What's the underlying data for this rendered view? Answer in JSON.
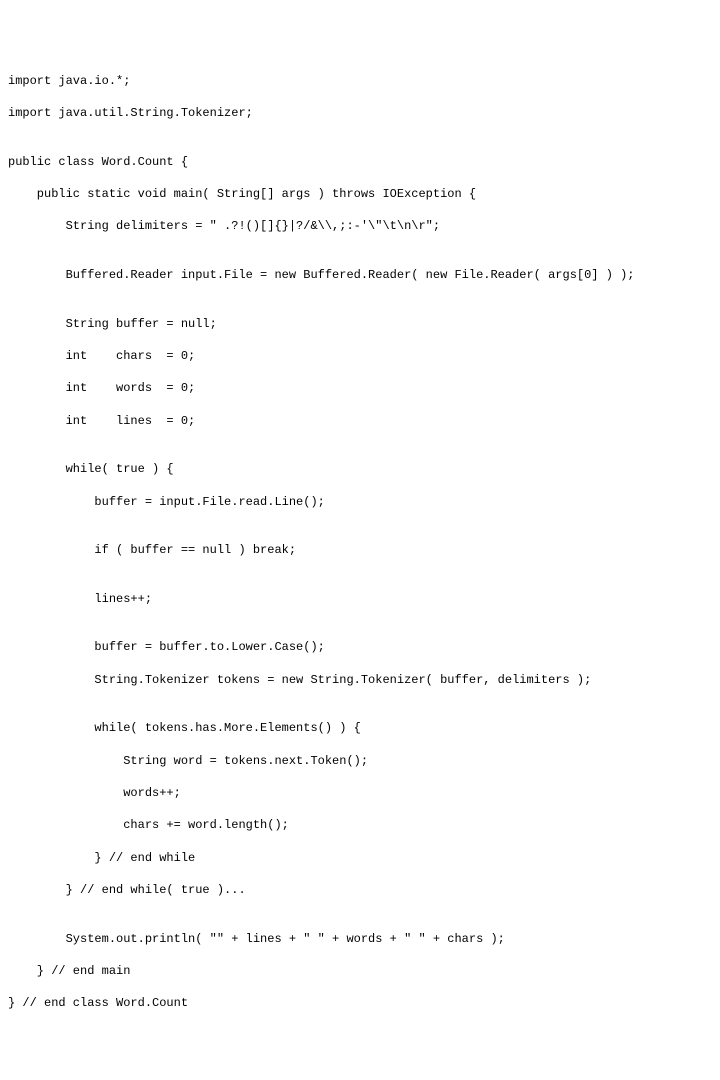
{
  "code": {
    "lines": [
      "import java.io.*;",
      "import java.util.String.Tokenizer;",
      "",
      "public class Word.Count {",
      "    public static void main( String[] args ) throws IOException {",
      "        String delimiters = \" .?!()[]{}|?/&\\\\,;:-'\\\"\\t\\n\\r\";",
      "",
      "        Buffered.Reader input.File = new Buffered.Reader( new File.Reader( args[0] ) );",
      "",
      "        String buffer = null;",
      "        int    chars  = 0;",
      "        int    words  = 0;",
      "        int    lines  = 0;",
      "",
      "        while( true ) {",
      "            buffer = input.File.read.Line();",
      "",
      "            if ( buffer == null ) break;",
      "",
      "            lines++;",
      "",
      "            buffer = buffer.to.Lower.Case();",
      "            String.Tokenizer tokens = new String.Tokenizer( buffer, delimiters );",
      "",
      "            while( tokens.has.More.Elements() ) {",
      "                String word = tokens.next.Token();",
      "                words++;",
      "                chars += word.length();",
      "            } // end while",
      "        } // end while( true )...",
      "",
      "        System.out.println( \"\" + lines + \" \" + words + \" \" + chars );",
      "    } // end main",
      "} // end class Word.Count"
    ]
  }
}
